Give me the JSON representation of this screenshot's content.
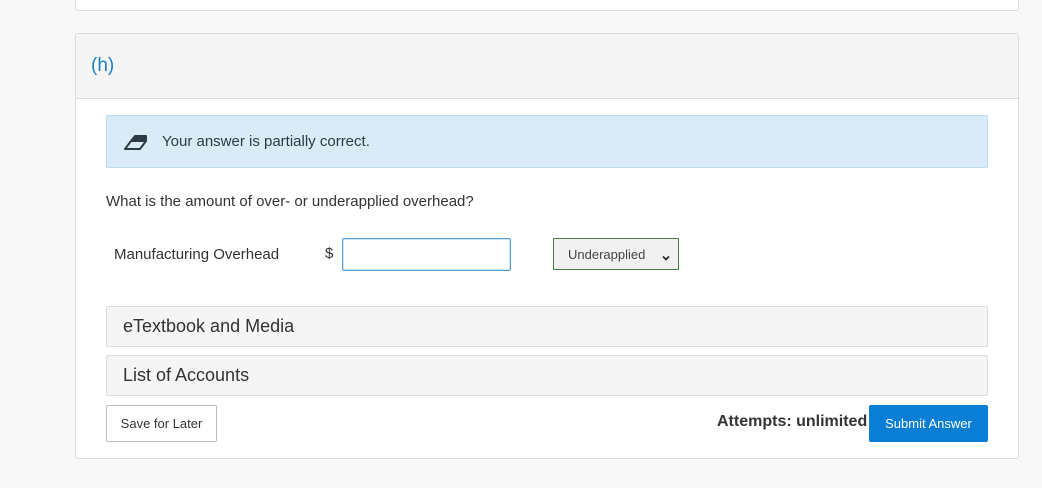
{
  "part": {
    "label": "(h)"
  },
  "feedback": {
    "message": "Your answer is partially correct.",
    "icon": "eraser-icon"
  },
  "question": {
    "text": "What is the amount of over- or underapplied overhead?"
  },
  "answer": {
    "label": "Manufacturing Overhead",
    "currency": "$",
    "value": "",
    "selected_option": "Underapplied"
  },
  "sections": [
    {
      "label": "eTextbook and Media"
    },
    {
      "label": "List of Accounts"
    }
  ],
  "footer": {
    "save_label": "Save for Later",
    "attempts_text": "Attempts: unlimited",
    "submit_label": "Submit Answer"
  },
  "colors": {
    "accent": "#0a7ed5",
    "part_label": "#1a7fc4",
    "alert_bg": "#d8ebf6",
    "select_border": "#4a7a46"
  }
}
